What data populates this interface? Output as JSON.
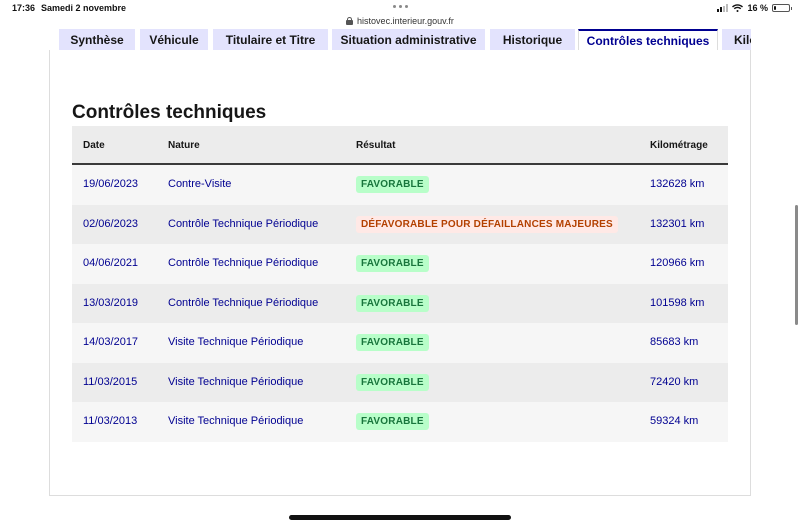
{
  "status_bar": {
    "time": "17:36",
    "date": "Samedi 2 novembre",
    "battery": "16 %",
    "battery_level": 0.16
  },
  "url_bar": {
    "domain": "histovec.interieur.gouv.fr"
  },
  "tabs": [
    {
      "label": "Synthèse",
      "active": false
    },
    {
      "label": "Véhicule",
      "active": false
    },
    {
      "label": "Titulaire et Titre",
      "active": false
    },
    {
      "label": "Situation administrative",
      "active": false
    },
    {
      "label": "Historique",
      "active": false
    },
    {
      "label": "Contrôles techniques",
      "active": true
    },
    {
      "label": "Kilo",
      "active": false
    }
  ],
  "section": {
    "title": "Contrôles techniques"
  },
  "table": {
    "headers": {
      "date": "Date",
      "nature": "Nature",
      "result": "Résultat",
      "mileage": "Kilométrage"
    },
    "rows": [
      {
        "date": "19/06/2023",
        "nature": "Contre-Visite",
        "result": "FAVORABLE",
        "status": "ok",
        "mileage": "132628 km"
      },
      {
        "date": "02/06/2023",
        "nature": "Contrôle Technique Périodique",
        "result": "DÉFAVORABLE POUR DÉFAILLANCES MAJEURES",
        "status": "ko",
        "mileage": "132301 km"
      },
      {
        "date": "04/06/2021",
        "nature": "Contrôle Technique Périodique",
        "result": "FAVORABLE",
        "status": "ok",
        "mileage": "120966 km"
      },
      {
        "date": "13/03/2019",
        "nature": "Contrôle Technique Périodique",
        "result": "FAVORABLE",
        "status": "ok",
        "mileage": "101598 km"
      },
      {
        "date": "14/03/2017",
        "nature": "Visite Technique Périodique",
        "result": "FAVORABLE",
        "status": "ok",
        "mileage": "85683 km"
      },
      {
        "date": "11/03/2015",
        "nature": "Visite Technique Périodique",
        "result": "FAVORABLE",
        "status": "ok",
        "mileage": "72420 km"
      },
      {
        "date": "11/03/2013",
        "nature": "Visite Technique Périodique",
        "result": "FAVORABLE",
        "status": "ok",
        "mileage": "59324 km"
      }
    ]
  },
  "colors": {
    "accent": "#000091",
    "favorable_bg": "#b8fec9",
    "favorable_text": "#18753c",
    "unfavorable_bg": "#ffe9e6",
    "unfavorable_text": "#b34000",
    "tab_bg": "#e3e3fd"
  }
}
